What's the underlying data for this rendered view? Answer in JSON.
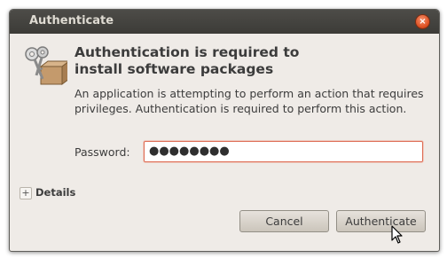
{
  "window": {
    "title": "Authenticate"
  },
  "icons": {
    "close": "close-icon",
    "keys": "keys-package-icon",
    "cursor": "mouse-pointer"
  },
  "dialog": {
    "heading_line1": "Authentication is required to",
    "heading_line2": "install software packages",
    "message": "An application is attempting to perform an action that requires privileges. Authentication is required to perform this action."
  },
  "password": {
    "label": "Password:",
    "masked_value": "●●●●●●●●"
  },
  "details": {
    "expander": "+",
    "label": "Details"
  },
  "buttons": {
    "cancel": "Cancel",
    "authenticate": "Authenticate"
  },
  "colors": {
    "titlebar": "#3c3b37",
    "dialog_bg": "#efebe7",
    "close_button": "#dc4a1b",
    "input_focus_border": "#de6c54"
  }
}
